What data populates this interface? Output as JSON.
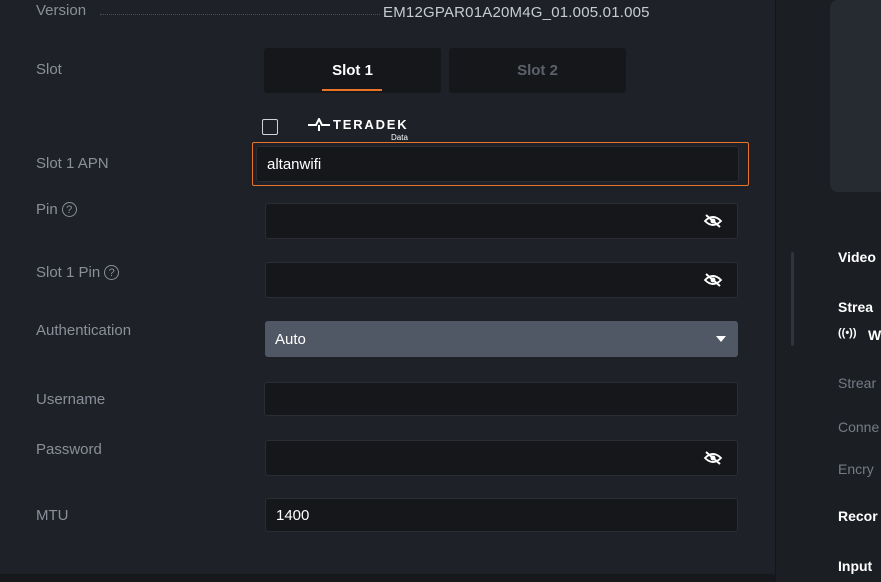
{
  "version": {
    "label": "Version",
    "value": "EM12GPAR01A20M4G_01.005.01.005"
  },
  "slot": {
    "label": "Slot",
    "tabs": [
      {
        "label": "Slot 1",
        "active": true
      },
      {
        "label": "Slot 2",
        "active": false
      }
    ]
  },
  "brand": {
    "name": "TERADEK",
    "sub": "Data",
    "checked": false
  },
  "apn": {
    "label": "Slot 1 APN",
    "value": "altanwifi"
  },
  "pin": {
    "label": "Pin",
    "help": "?",
    "value": ""
  },
  "slot1_pin": {
    "label": "Slot 1 Pin",
    "help": "?",
    "value": ""
  },
  "auth": {
    "label": "Authentication",
    "value": "Auto"
  },
  "username": {
    "label": "Username",
    "value": ""
  },
  "password": {
    "label": "Password",
    "value": ""
  },
  "mtu": {
    "label": "MTU",
    "value": "1400"
  },
  "right_panel": {
    "video": "Video",
    "stream_head": "Strea",
    "wifi_symbol": "((•))",
    "wifi_text": "W",
    "stream": "Strear",
    "connection": "Conne",
    "encryption": "Encry",
    "record": "Recor",
    "input": "Input"
  },
  "colors": {
    "accent": "#e8742a",
    "panel": "#1e2128",
    "field": "#15171b",
    "select": "#515865"
  },
  "icons": {
    "hidden": "eye-slash-icon",
    "help": "question-circle-icon",
    "dropdown": "caret-down-icon"
  }
}
